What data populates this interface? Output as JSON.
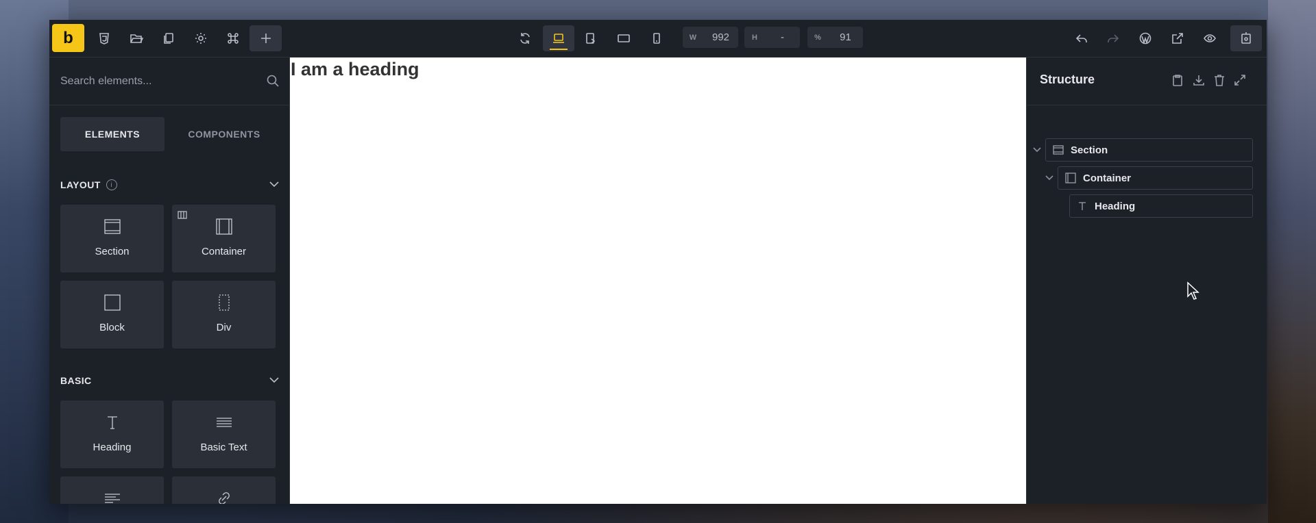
{
  "toolbar": {
    "logo": "b",
    "left_icons": [
      "css3-icon",
      "folder-open-icon",
      "copy-pages-icon",
      "settings-gear-icon",
      "command-icon",
      "plus-icon"
    ],
    "device_icons": [
      "refresh-icon",
      "laptop-icon",
      "tablet-landscape-icon",
      "tablet-icon",
      "mobile-icon"
    ],
    "width_label": "W",
    "width_value": "992",
    "height_label": "H",
    "height_value": "-",
    "zoom_label": "%",
    "zoom_value": "91",
    "right_icons": [
      "undo-icon",
      "redo-icon",
      "wordpress-icon",
      "external-link-icon",
      "eye-icon",
      "save-icon"
    ]
  },
  "sidebar": {
    "search_placeholder": "Search elements...",
    "tabs": [
      "ELEMENTS",
      "COMPONENTS"
    ],
    "active_tab": "ELEMENTS",
    "categories": [
      {
        "title": "LAYOUT",
        "info": "i",
        "items": [
          "Section",
          "Container",
          "Block",
          "Div"
        ]
      },
      {
        "title": "BASIC",
        "items": [
          "Heading",
          "Basic Text",
          "",
          ""
        ]
      }
    ]
  },
  "canvas": {
    "heading": "I am a heading"
  },
  "structure": {
    "title": "Structure",
    "actions": [
      "clipboard-icon",
      "download-icon",
      "trash-icon",
      "expand-icon"
    ],
    "tree": [
      {
        "label": "Section",
        "icon": "section-icon"
      },
      {
        "label": "Container",
        "icon": "container-icon"
      },
      {
        "label": "Heading",
        "icon": "text-icon"
      }
    ]
  }
}
